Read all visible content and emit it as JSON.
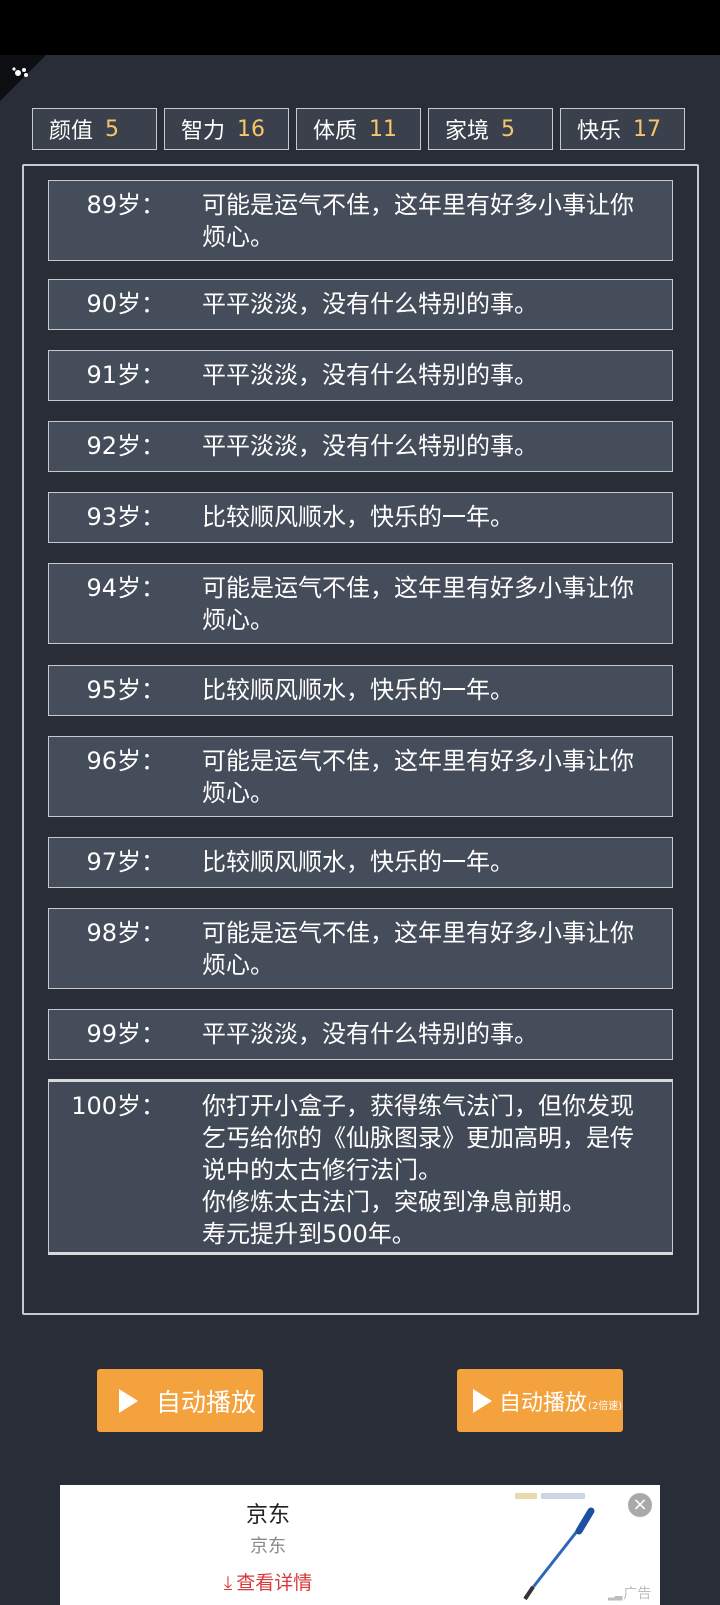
{
  "stats": [
    {
      "label": "颜值",
      "value": "5"
    },
    {
      "label": "智力",
      "value": "16"
    },
    {
      "label": "体质",
      "value": "11"
    },
    {
      "label": "家境",
      "value": "5"
    },
    {
      "label": "快乐",
      "value": "17"
    }
  ],
  "log": [
    {
      "age": "89岁：",
      "text": "可能是运气不佳，这年里有好多小事让你烦心。"
    },
    {
      "age": "90岁：",
      "text": "平平淡淡，没有什么特别的事。"
    },
    {
      "age": "91岁：",
      "text": "平平淡淡，没有什么特别的事。"
    },
    {
      "age": "92岁：",
      "text": "平平淡淡，没有什么特别的事。"
    },
    {
      "age": "93岁：",
      "text": "比较顺风顺水，快乐的一年。"
    },
    {
      "age": "94岁：",
      "text": "可能是运气不佳，这年里有好多小事让你烦心。"
    },
    {
      "age": "95岁：",
      "text": "比较顺风顺水，快乐的一年。"
    },
    {
      "age": "96岁：",
      "text": "可能是运气不佳，这年里有好多小事让你烦心。"
    },
    {
      "age": "97岁：",
      "text": "比较顺风顺水，快乐的一年。"
    },
    {
      "age": "98岁：",
      "text": "可能是运气不佳，这年里有好多小事让你烦心。"
    },
    {
      "age": "99岁：",
      "text": "平平淡淡，没有什么特别的事。"
    },
    {
      "age": "100岁：",
      "text": "你打开小盒子，获得练气法门，但你发现乞丐给你的《仙脉图录》更加高明，是传说中的太古修行法门。\n你修炼太古法门，突破到净息前期。\n寿元提升到500年。"
    }
  ],
  "buttons": {
    "autoplay_label": "自动播放",
    "autoplay2_label": "自动播放",
    "autoplay2_suffix": "(2倍速)"
  },
  "ad": {
    "title": "京东",
    "subtitle": "京东",
    "link": "查看详情",
    "label": "广告",
    "close": "×"
  }
}
